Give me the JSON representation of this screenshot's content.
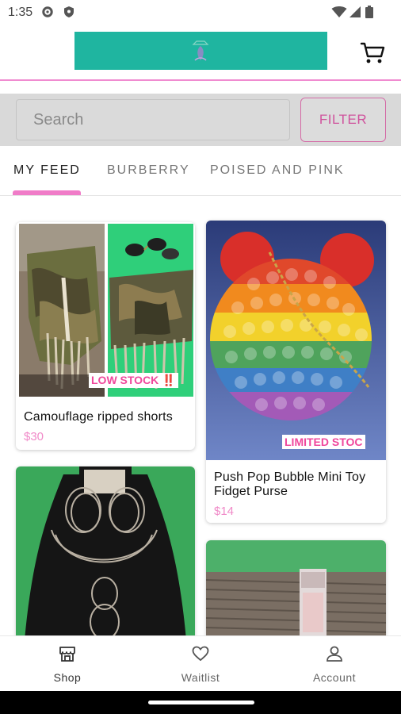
{
  "status_bar": {
    "time": "1:35",
    "icons": [
      "gear-icon",
      "shield-icon",
      "wifi-icon",
      "signal-icon",
      "battery-icon"
    ]
  },
  "header": {
    "logo_color": "#1fb5a0",
    "accent_color": "#f08bd0",
    "cart_icon": "cart-icon"
  },
  "search": {
    "placeholder": "Search",
    "value": "",
    "filter_label": "FILTER"
  },
  "tabs": [
    {
      "label": "MY FEED",
      "active": true
    },
    {
      "label": "BURBERRY",
      "active": false
    },
    {
      "label": "POISED AND PINK",
      "active": false
    }
  ],
  "feed": {
    "items": [
      {
        "title": "Camouflage ripped shorts",
        "price": "$30",
        "badge": "LOW STOCK ‼️"
      },
      {
        "title": "Push Pop Bubble Mini Toy Fidget Purse",
        "price": "$14",
        "badge": "LIMITED STOC"
      },
      {
        "title": "",
        "price": "",
        "badge": ""
      },
      {
        "title": "",
        "price": "",
        "badge": ""
      }
    ]
  },
  "bottom_nav": {
    "items": [
      {
        "label": "Shop",
        "icon": "shop-icon",
        "active": true
      },
      {
        "label": "Waitlist",
        "icon": "heart-icon",
        "active": false
      },
      {
        "label": "Account",
        "icon": "account-icon",
        "active": false
      }
    ]
  },
  "colors": {
    "price": "#f08ac8",
    "badge": "#f0479c",
    "tab_underline": "#f07cc8"
  }
}
